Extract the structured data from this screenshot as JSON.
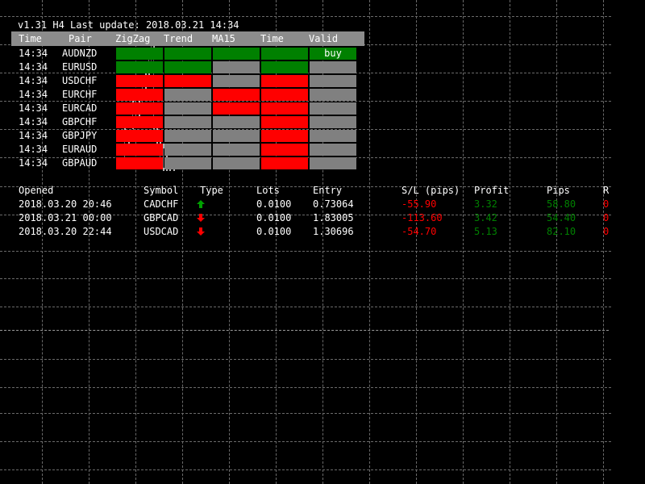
{
  "header": {
    "title": "v1.31 H4 Last update: 2018.03.21 14:34"
  },
  "signal_table": {
    "columns": [
      "Time",
      "Pair",
      "ZigZag",
      "Trend",
      "MA15",
      "Time",
      "Valid"
    ],
    "rows": [
      {
        "time": "14:34",
        "pair": "AUDNZD",
        "zigzag": "green",
        "trend": "green",
        "ma15": "green",
        "time2": "green",
        "valid": "green",
        "valid_label": "buy"
      },
      {
        "time": "14:34",
        "pair": "EURUSD",
        "zigzag": "green",
        "trend": "green",
        "ma15": "gray",
        "time2": "green",
        "valid": "gray",
        "valid_label": ""
      },
      {
        "time": "14:34",
        "pair": "USDCHF",
        "zigzag": "red",
        "trend": "red",
        "ma15": "gray",
        "time2": "red",
        "valid": "gray",
        "valid_label": ""
      },
      {
        "time": "14:34",
        "pair": "EURCHF",
        "zigzag": "red",
        "trend": "gray",
        "ma15": "red",
        "time2": "red",
        "valid": "gray",
        "valid_label": ""
      },
      {
        "time": "14:34",
        "pair": "EURCAD",
        "zigzag": "red",
        "trend": "gray",
        "ma15": "red",
        "time2": "red",
        "valid": "gray",
        "valid_label": ""
      },
      {
        "time": "14:34",
        "pair": "GBPCHF",
        "zigzag": "red",
        "trend": "gray",
        "ma15": "gray",
        "time2": "red",
        "valid": "gray",
        "valid_label": ""
      },
      {
        "time": "14:34",
        "pair": "GBPJPY",
        "zigzag": "red",
        "trend": "gray",
        "ma15": "gray",
        "time2": "red",
        "valid": "gray",
        "valid_label": ""
      },
      {
        "time": "14:34",
        "pair": "EURAUD",
        "zigzag": "red",
        "trend": "gray",
        "ma15": "gray",
        "time2": "red",
        "valid": "gray",
        "valid_label": ""
      },
      {
        "time": "14:34",
        "pair": "GBPAUD",
        "zigzag": "red",
        "trend": "gray",
        "ma15": "gray",
        "time2": "red",
        "valid": "gray",
        "valid_label": ""
      }
    ]
  },
  "trades_table": {
    "columns": [
      "Opened",
      "Symbol",
      "Type",
      "Lots",
      "Entry",
      "S/L (pips)",
      "Profit",
      "Pips",
      "R"
    ],
    "rows": [
      {
        "opened": "2018.03.20 20:46",
        "symbol": "CADCHF",
        "type": "up",
        "lots": "0.0100",
        "entry": "0.73064",
        "sl": "-55.90",
        "profit": "3.32",
        "pips": "58.80",
        "r": "0"
      },
      {
        "opened": "2018.03.21 00:00",
        "symbol": "GBPCAD",
        "type": "down",
        "lots": "0.0100",
        "entry": "1.83005",
        "sl": "-113.60",
        "profit": "3.42",
        "pips": "54.40",
        "r": "0"
      },
      {
        "opened": "2018.03.20 22:44",
        "symbol": "USDCAD",
        "type": "down",
        "lots": "0.0100",
        "entry": "1.30696",
        "sl": "-54.70",
        "profit": "5.13",
        "pips": "82.10",
        "r": "0"
      }
    ]
  },
  "colors": {
    "green": "#008000",
    "red": "#ff0000",
    "gray": "#808080",
    "header": "#8c8c8c",
    "arrow_up": "#00a000",
    "arrow_down": "#ff0000"
  },
  "icons": {
    "up": "arrow-up-icon",
    "down": "arrow-down-icon"
  }
}
